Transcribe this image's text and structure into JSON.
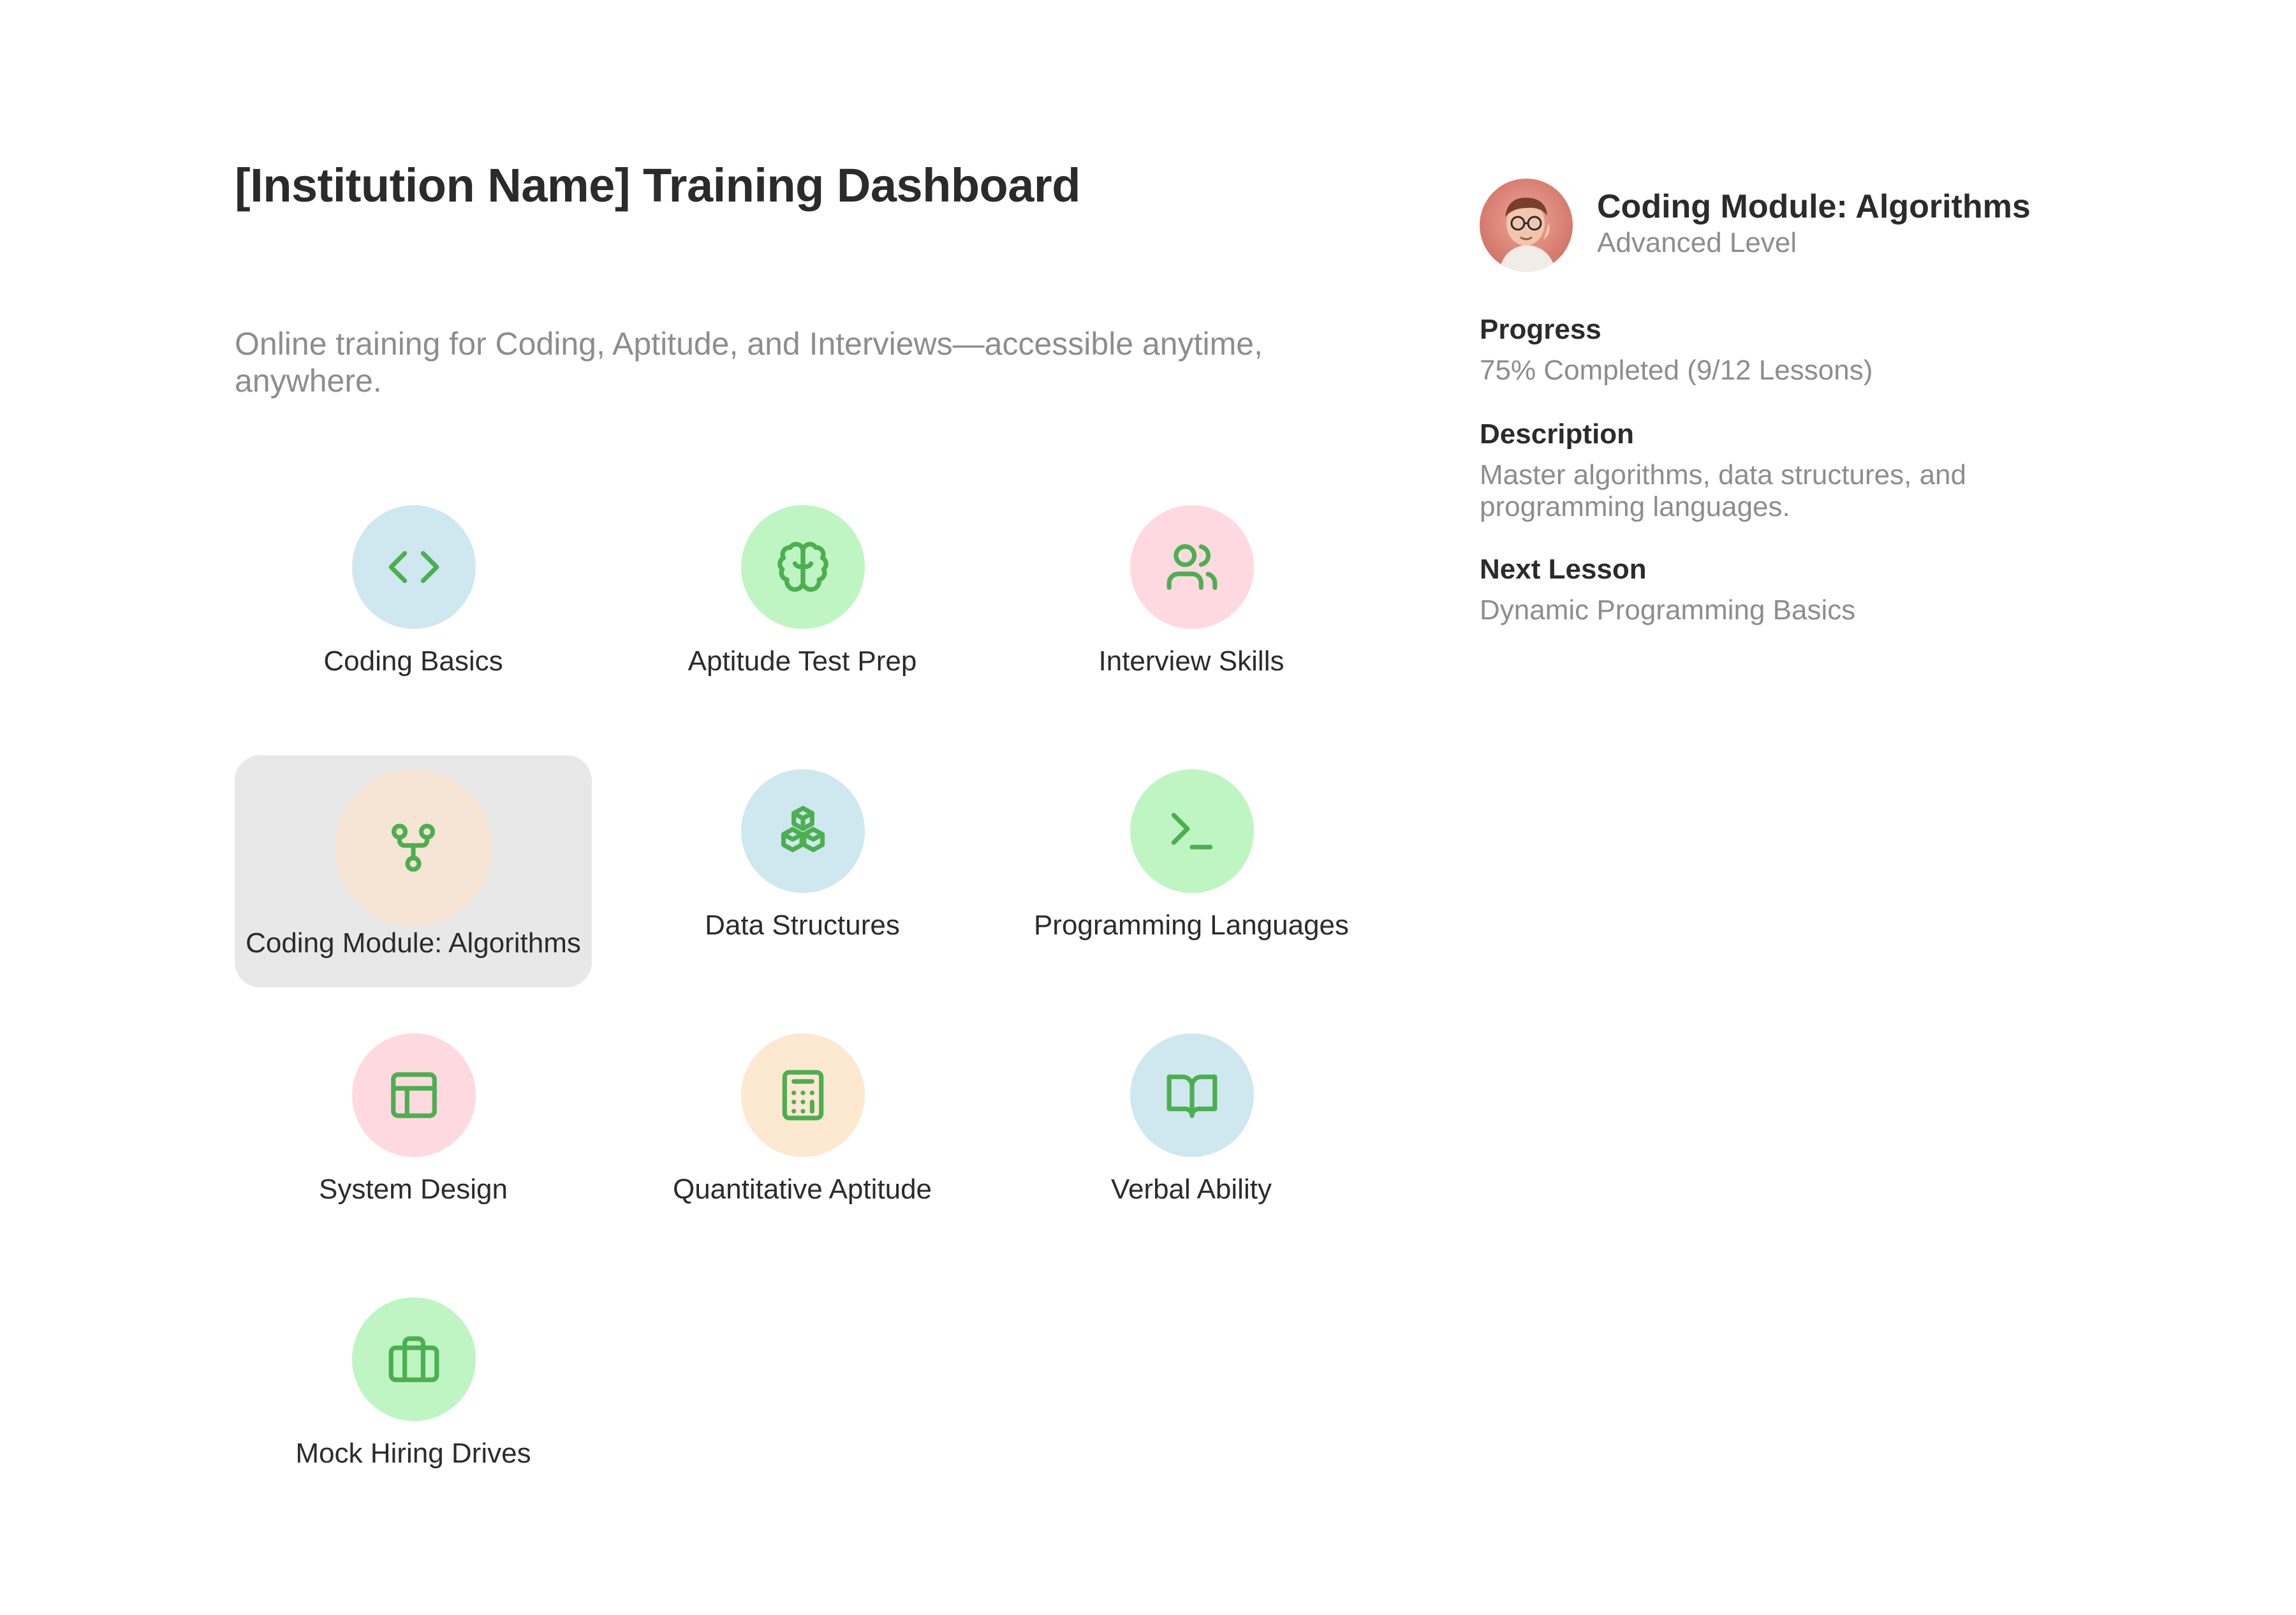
{
  "header": {
    "title": "[Institution Name] Training Dashboard",
    "subtitle": "Online training for Coding, Aptitude, and Interviews—accessible anytime, anywhere."
  },
  "theme": {
    "icon_color": "#4caf50",
    "selected_tile_bg": "#e8e8e8"
  },
  "modules": [
    {
      "label": "Coding Basics",
      "icon": "code-icon",
      "bg": "#cfe8ef",
      "selected": false
    },
    {
      "label": "Aptitude Test Prep",
      "icon": "brain-icon",
      "bg": "#bff5c2",
      "selected": false
    },
    {
      "label": "Interview Skills",
      "icon": "users-icon",
      "bg": "#ffd9e0",
      "selected": false
    },
    {
      "label": "Coding Module: Algorithms",
      "icon": "git-fork-icon",
      "bg": "#f6e4d4",
      "selected": true
    },
    {
      "label": "Data Structures",
      "icon": "boxes-icon",
      "bg": "#cfe8ef",
      "selected": false
    },
    {
      "label": "Programming Languages",
      "icon": "terminal-icon",
      "bg": "#bff5c2",
      "selected": false
    },
    {
      "label": "System Design",
      "icon": "layout-icon",
      "bg": "#ffd9e0",
      "selected": false
    },
    {
      "label": "Quantitative Aptitude",
      "icon": "calculator-icon",
      "bg": "#fde8d2",
      "selected": false
    },
    {
      "label": "Verbal Ability",
      "icon": "book-open-icon",
      "bg": "#cfe8ef",
      "selected": false
    },
    {
      "label": "Mock Hiring Drives",
      "icon": "briefcase-icon",
      "bg": "#bff5c2",
      "selected": false
    }
  ],
  "details": {
    "title": "Coding Module: Algorithms",
    "level": "Advanced Level",
    "progress_heading": "Progress",
    "progress_text": "75% Completed (9/12 Lessons)",
    "progress_fraction": 0.75,
    "description_heading": "Description",
    "description_text": "Master algorithms, data structures, and programming languages.",
    "next_heading": "Next Lesson",
    "next_text": "Dynamic Programming Basics"
  }
}
